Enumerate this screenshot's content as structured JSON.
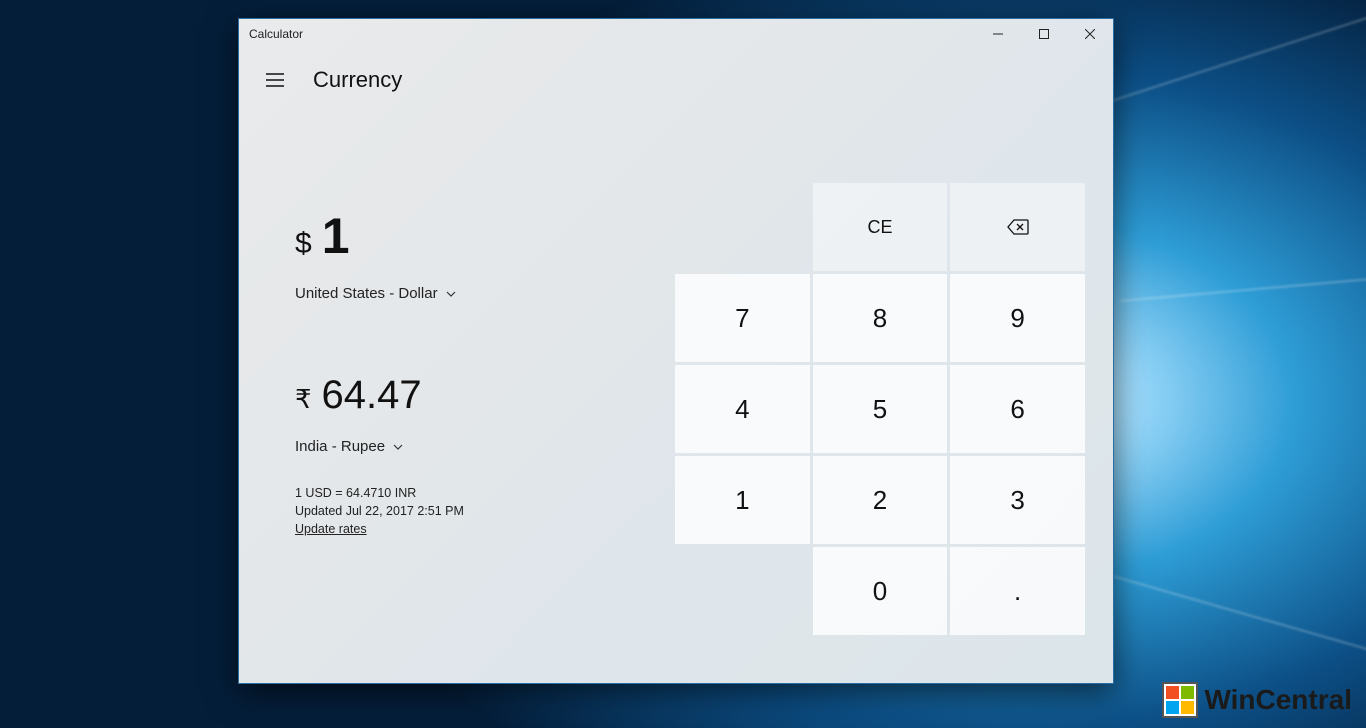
{
  "window": {
    "title": "Calculator",
    "mode": "Currency"
  },
  "from": {
    "symbol": "$",
    "value": "1",
    "unit": "United States - Dollar"
  },
  "to": {
    "symbol": "₹",
    "value": "64.47",
    "unit": "India - Rupee"
  },
  "rate": {
    "line": "1 USD = 64.4710 INR",
    "updated": "Updated Jul 22, 2017 2:51 PM",
    "update_link": "Update rates"
  },
  "keys": {
    "ce": "CE",
    "n7": "7",
    "n8": "8",
    "n9": "9",
    "n4": "4",
    "n5": "5",
    "n6": "6",
    "n1": "1",
    "n2": "2",
    "n3": "3",
    "n0": "0",
    "dot": "."
  },
  "watermark": "WinCentral"
}
